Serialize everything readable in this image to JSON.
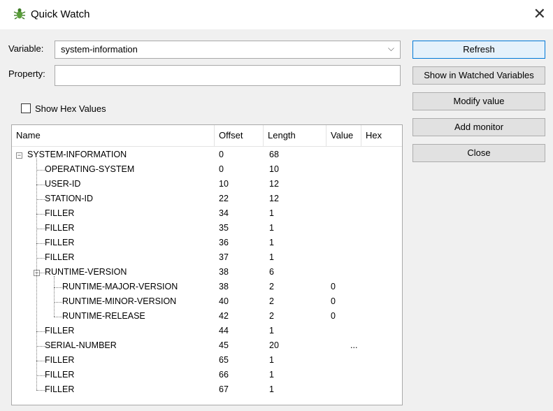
{
  "window": {
    "title": "Quick Watch"
  },
  "form": {
    "variable_label": "Variable:",
    "variable_value": "system-information",
    "property_label": "Property:",
    "property_value": "",
    "show_hex_label": "Show Hex Values",
    "show_hex_checked": false
  },
  "tree": {
    "columns": [
      "Name",
      "Offset",
      "Length",
      "Value",
      "Hex"
    ],
    "rows": [
      {
        "name": "SYSTEM-INFORMATION",
        "offset": "0",
        "length": "68",
        "value": "",
        "hex": "",
        "depth": 0,
        "expander": "minus"
      },
      {
        "name": "OPERATING-SYSTEM",
        "offset": "0",
        "length": "10",
        "value": "",
        "hex": "",
        "depth": 1
      },
      {
        "name": "USER-ID",
        "offset": "10",
        "length": "12",
        "value": "",
        "hex": "",
        "depth": 1
      },
      {
        "name": "STATION-ID",
        "offset": "22",
        "length": "12",
        "value": "",
        "hex": "",
        "depth": 1
      },
      {
        "name": "FILLER",
        "offset": "34",
        "length": "1",
        "value": "",
        "hex": "",
        "depth": 1
      },
      {
        "name": "FILLER",
        "offset": "35",
        "length": "1",
        "value": "",
        "hex": "",
        "depth": 1
      },
      {
        "name": "FILLER",
        "offset": "36",
        "length": "1",
        "value": "",
        "hex": "",
        "depth": 1
      },
      {
        "name": "FILLER",
        "offset": "37",
        "length": "1",
        "value": "",
        "hex": "",
        "depth": 1
      },
      {
        "name": "RUNTIME-VERSION",
        "offset": "38",
        "length": "6",
        "value": "",
        "hex": "",
        "depth": 1,
        "expander": "minus"
      },
      {
        "name": "RUNTIME-MAJOR-VERSION",
        "offset": "38",
        "length": "2",
        "value": "0",
        "hex": "",
        "depth": 2
      },
      {
        "name": "RUNTIME-MINOR-VERSION",
        "offset": "40",
        "length": "2",
        "value": "0",
        "hex": "",
        "depth": 2
      },
      {
        "name": "RUNTIME-RELEASE",
        "offset": "42",
        "length": "2",
        "value": "0",
        "hex": "",
        "depth": 2
      },
      {
        "name": "FILLER",
        "offset": "44",
        "length": "1",
        "value": "",
        "hex": "",
        "depth": 1
      },
      {
        "name": "SERIAL-NUMBER",
        "offset": "45",
        "length": "20",
        "value": "...",
        "hex": "",
        "depth": 1
      },
      {
        "name": "FILLER",
        "offset": "65",
        "length": "1",
        "value": "",
        "hex": "",
        "depth": 1
      },
      {
        "name": "FILLER",
        "offset": "66",
        "length": "1",
        "value": "",
        "hex": "",
        "depth": 1
      },
      {
        "name": "FILLER",
        "offset": "67",
        "length": "1",
        "value": "",
        "hex": "",
        "depth": 1
      }
    ]
  },
  "buttons": {
    "refresh": "Refresh",
    "show_watched": "Show in Watched Variables",
    "modify": "Modify value",
    "add_monitor": "Add monitor",
    "close": "Close"
  },
  "icons": {
    "app": "bug-icon",
    "close": "close-icon",
    "dropdown": "chevron-down-icon"
  }
}
